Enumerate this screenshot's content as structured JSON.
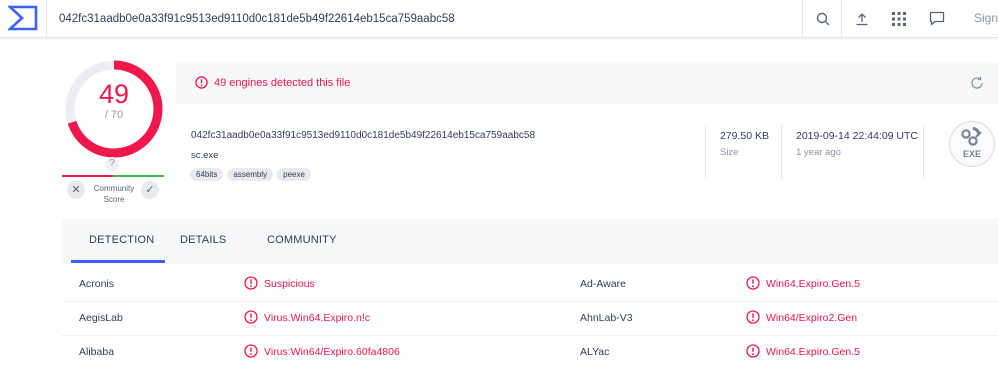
{
  "topbar": {
    "search_value": "042fc31aadb0e0a33f91c9513ed9110d0c181de5b49f22614eb15ca759aabc58",
    "icons": [
      "search-icon",
      "upload-icon",
      "grid-icon",
      "chat-icon"
    ],
    "signin_label": "Sign"
  },
  "score": {
    "detected": "49",
    "total": "/ 70",
    "ratio": 0.7,
    "community_label_1": "Community",
    "community_label_2": "Score",
    "question": "?"
  },
  "banner": {
    "text": "49 engines detected this file"
  },
  "file": {
    "hash": "042fc31aadb0e0a33f91c9513ed9110d0c181de5b49f22614eb15ca759aabc58",
    "name": "sc.exe",
    "tags": [
      "64bits",
      "assembly",
      "peexe"
    ],
    "size": "279.50 KB",
    "size_label": "Size",
    "date": "2019-09-14 22:44:09 UTC",
    "date_ago": "1 year ago",
    "type_badge": "EXE"
  },
  "tabs": [
    {
      "label": "DETECTION"
    },
    {
      "label": "DETAILS"
    },
    {
      "label": "COMMUNITY"
    }
  ],
  "detections": [
    {
      "engine_a": "Acronis",
      "result_a": "Suspicious",
      "engine_b": "Ad-Aware",
      "result_b": "Win64.Expiro.Gen.5"
    },
    {
      "engine_a": "AegisLab",
      "result_a": "Virus.Win64.Expiro.n!c",
      "engine_b": "AhnLab-V3",
      "result_b": "Win64/Expiro2.Gen"
    },
    {
      "engine_a": "Alibaba",
      "result_a": "Virus:Win64/Expiro.60fa4806",
      "engine_b": "ALYac",
      "result_b": "Win64.Expiro.Gen.5"
    }
  ],
  "colors": {
    "accent": "#3b61ff",
    "malicious": "#f0174b",
    "harmless": "#3cba54"
  }
}
